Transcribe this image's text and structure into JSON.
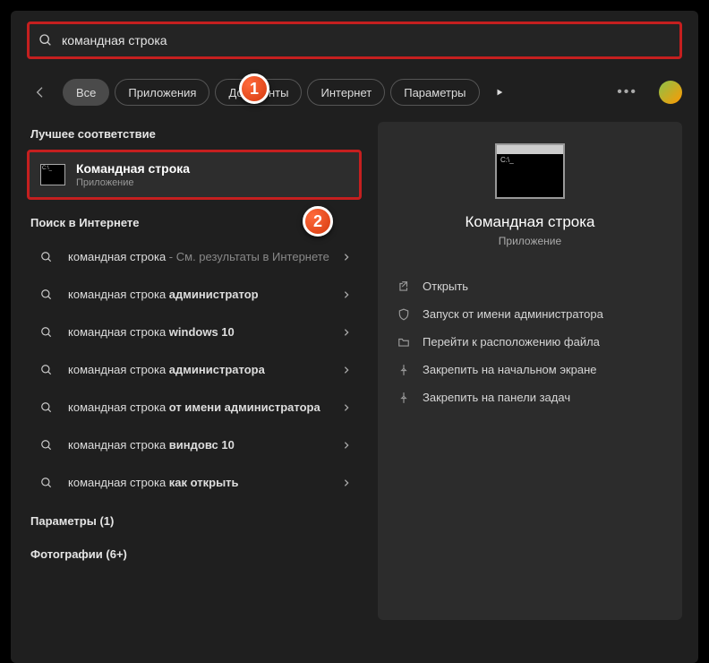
{
  "search": {
    "query": "командная строка",
    "placeholder": ""
  },
  "filters": {
    "all": "Все",
    "apps": "Приложения",
    "documents": "Документы",
    "internet": "Интернет",
    "settings": "Параметры"
  },
  "sections": {
    "best_match": "Лучшее соответствие",
    "web_search": "Поиск в Интернете",
    "settings_group": "Параметры (1)",
    "photos_group": "Фотографии (6+)"
  },
  "best_match": {
    "title": "Командная строка",
    "subtitle": "Приложение"
  },
  "web_results": [
    {
      "prefix": "командная строка",
      "suffix": " - См. результаты в Интернете",
      "bold": ""
    },
    {
      "prefix": "командная строка ",
      "suffix": "",
      "bold": "администратор"
    },
    {
      "prefix": "командная строка ",
      "suffix": "",
      "bold": "windows 10"
    },
    {
      "prefix": "командная строка ",
      "suffix": "",
      "bold": "администратора"
    },
    {
      "prefix": "командная строка ",
      "suffix": "",
      "bold": "от имени администратора"
    },
    {
      "prefix": "командная строка ",
      "suffix": "",
      "bold": "виндовс 10"
    },
    {
      "prefix": "командная строка ",
      "suffix": "",
      "bold": "как открыть"
    }
  ],
  "panel": {
    "title": "Командная строка",
    "subtitle": "Приложение",
    "actions": {
      "open": "Открыть",
      "run_admin": "Запуск от имени администратора",
      "file_location": "Перейти к расположению файла",
      "pin_start": "Закрепить на начальном экране",
      "pin_taskbar": "Закрепить на панели задач"
    }
  },
  "badges": {
    "one": "1",
    "two": "2"
  }
}
